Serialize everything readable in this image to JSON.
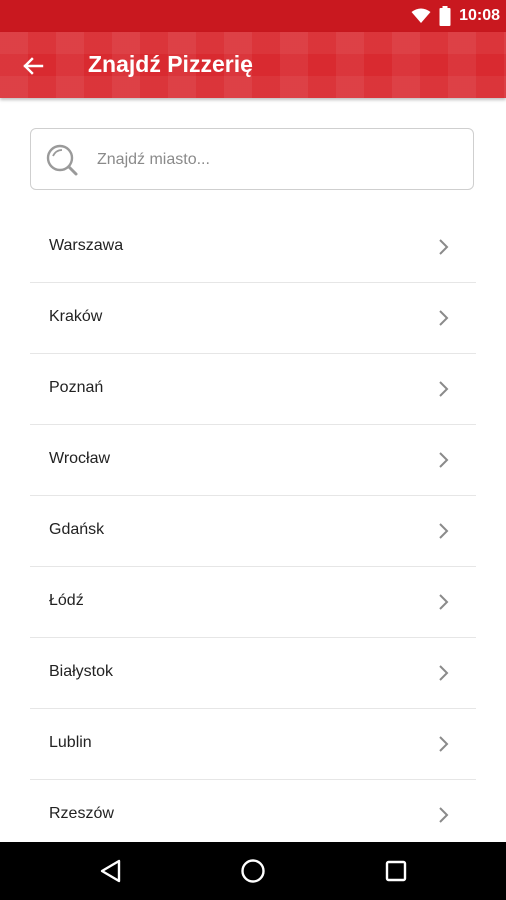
{
  "status_bar": {
    "time": "10:08",
    "icons": [
      "wifi-icon",
      "battery-icon"
    ]
  },
  "app_bar": {
    "title": "Znajdź Pizzerię",
    "back_icon": "arrow-left-icon"
  },
  "search": {
    "placeholder": "Znajdź miasto...",
    "value": "",
    "icon": "search-icon"
  },
  "cities": [
    {
      "label": "Warszawa"
    },
    {
      "label": "Kraków"
    },
    {
      "label": "Poznań"
    },
    {
      "label": "Wrocław"
    },
    {
      "label": "Gdańsk"
    },
    {
      "label": "Łódź"
    },
    {
      "label": "Białystok"
    },
    {
      "label": "Lublin"
    },
    {
      "label": "Rzeszów"
    }
  ],
  "nav": [
    "back-triangle-icon",
    "home-circle-icon",
    "recents-square-icon"
  ],
  "colors": {
    "primary": "#d92a30",
    "status_bar": "#c9181f",
    "nav_bar": "#000000"
  }
}
